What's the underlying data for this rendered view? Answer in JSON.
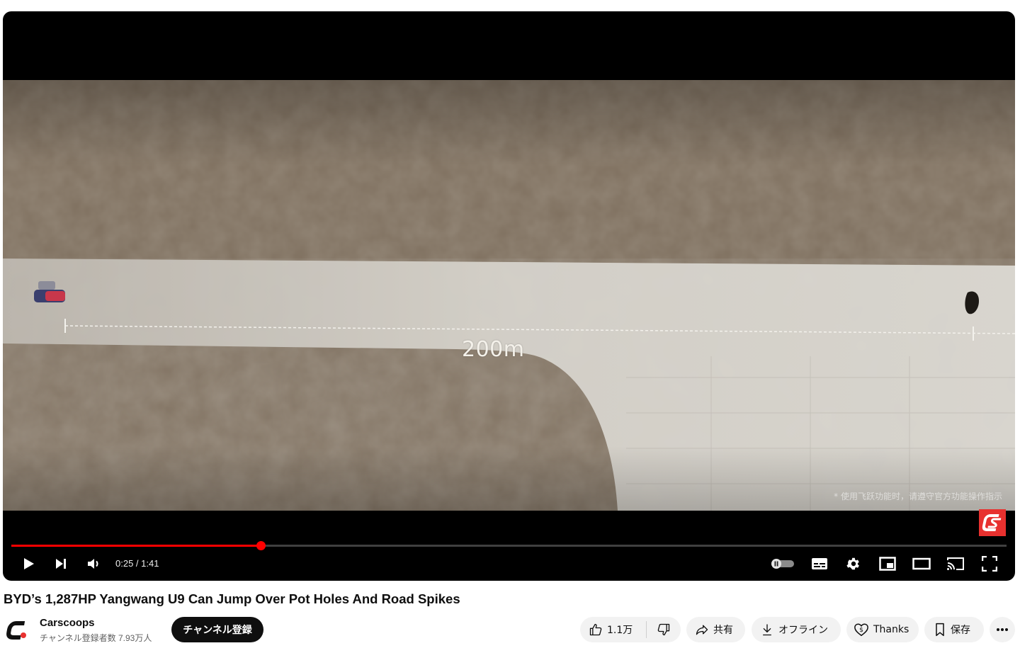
{
  "video": {
    "overlay_distance": "200m",
    "disclaimer": "* 使用飞跃功能时，请遵守官方功能操作指示",
    "progress_fraction": 0.2505,
    "colors": {
      "progress": "#ff0000",
      "accent": "#ff0000"
    }
  },
  "controls": {
    "time": "0:25 / 1:41",
    "left": [
      "play-icon",
      "next-icon",
      "volume-icon"
    ],
    "right": [
      "autoplay-toggle-icon",
      "subtitles-icon",
      "settings-gear-icon",
      "miniplayer-icon",
      "theater-mode-icon",
      "cast-icon",
      "fullscreen-icon"
    ]
  },
  "title": "BYD’s 1,287HP Yangwang U9 Can Jump Over Pot Holes And Road Spikes",
  "channel": {
    "name": "Carscoops",
    "subscribers": "チャンネル登録者数 7.93万人",
    "subscribe_label": "チャンネル登録"
  },
  "actions": {
    "like_count": "1.1万",
    "share_label": "共有",
    "download_label": "オフライン",
    "thanks_label": "Thanks",
    "save_label": "保存"
  }
}
